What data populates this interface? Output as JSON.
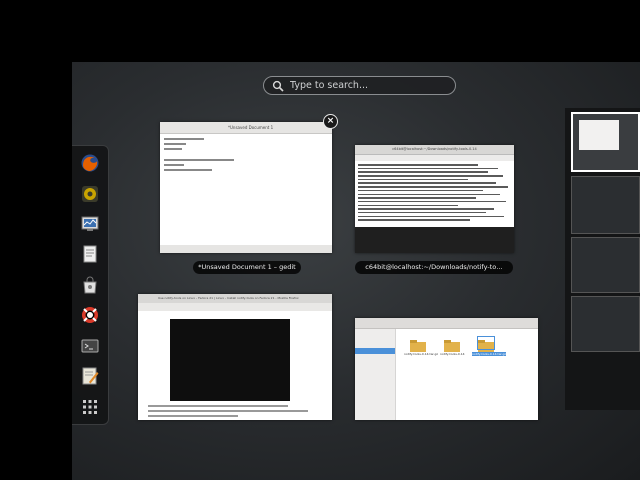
{
  "search": {
    "placeholder": "Type to search..."
  },
  "dash": {
    "items": [
      {
        "name": "firefox-icon",
        "color": "#e66000"
      },
      {
        "name": "rhythmbox-icon",
        "color": "#c9a400"
      },
      {
        "name": "system-monitor-icon",
        "color": "#3a6fb0"
      },
      {
        "name": "text-editor-icon",
        "color": "#8a8a8a"
      },
      {
        "name": "software-center-icon",
        "color": "#7a7a7a"
      },
      {
        "name": "help-icon",
        "color": "#d83a2a"
      },
      {
        "name": "terminal-icon",
        "color": "#444444"
      },
      {
        "name": "gedit-icon",
        "color": "#e9e6d9"
      },
      {
        "name": "show-applications-icon",
        "color": "#cccccc"
      }
    ]
  },
  "windows": {
    "gedit": {
      "caption": "*Unsaved Document 1 – gedit",
      "tab_title": "*Unsaved Document 1"
    },
    "terminal": {
      "caption": "c64bit@localhost:~/Downloads/notify-to…",
      "title": "c64bit@localhost:~/Downloads/notify-tools-0.14"
    },
    "firefox": {
      "title": "Use notify-tools on Linux - Fedora 21 | Linux - Install notify-tools on Fedora 21 - Mozilla Firefox"
    },
    "files": {
      "folders": [
        {
          "label": "notify-tools-0.14.tar.gz"
        },
        {
          "label": "notify-tools-0.14"
        },
        {
          "label": "notify-tools-0.14.tar.gz"
        }
      ]
    }
  },
  "colors": {
    "accent": "#4a90d9",
    "folder": "#e2b24a"
  }
}
